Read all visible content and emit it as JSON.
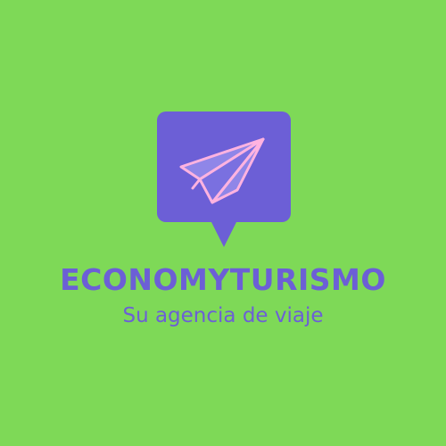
{
  "brand": {
    "name": "ECONOMYTURISMO",
    "tagline": "Su agencia de viaje"
  },
  "colors": {
    "background": "#7ed957",
    "accent": "#6c5fd6",
    "plane_fill": "#8f86e8",
    "plane_outline": "#ffb3e0"
  },
  "icons": {
    "logo_bubble": "speech-bubble-icon",
    "logo_plane": "paper-plane-icon"
  }
}
